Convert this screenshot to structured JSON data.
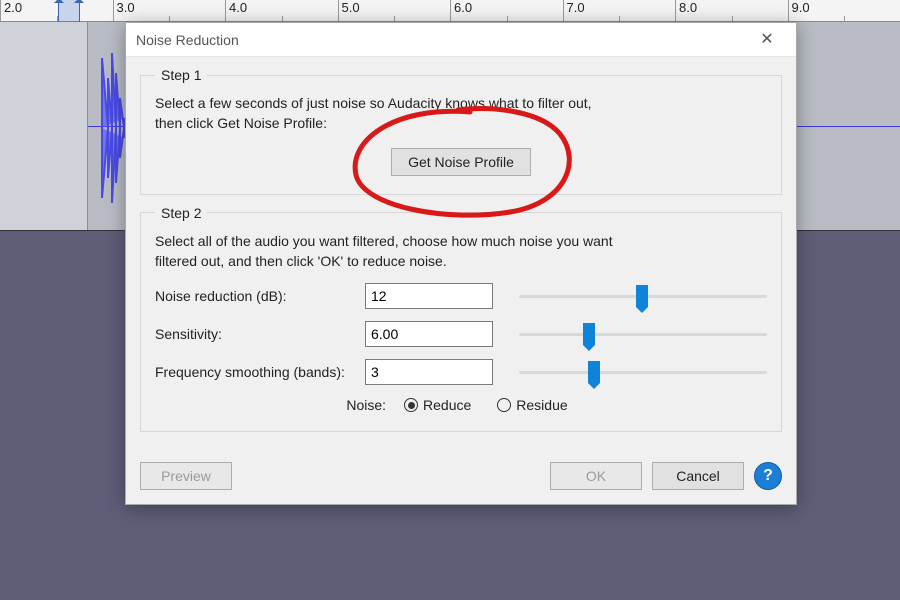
{
  "ruler": {
    "ticks": [
      "2.0",
      "3.0",
      "4.0",
      "5.0",
      "6.0",
      "7.0",
      "8.0",
      "9.0"
    ]
  },
  "dialog": {
    "title": "Noise Reduction",
    "step1": {
      "legend": "Step 1",
      "text_line1": "Select a few seconds of just noise so Audacity knows what to filter out,",
      "text_line2": "then click Get Noise Profile:",
      "button": "Get Noise Profile"
    },
    "step2": {
      "legend": "Step 2",
      "text_line1": "Select all of the audio you want filtered, choose how much noise you want",
      "text_line2": "filtered out, and then click 'OK' to reduce noise.",
      "params": {
        "noise_reduction": {
          "label": "Noise reduction (dB):",
          "value": "12",
          "slider_pct": 47
        },
        "sensitivity": {
          "label": "Sensitivity:",
          "value": "6.00",
          "slider_pct": 26
        },
        "freq_smoothing": {
          "label": "Frequency smoothing (bands):",
          "value": "3",
          "slider_pct": 28
        }
      },
      "noise_label": "Noise:",
      "noise_options": {
        "reduce": "Reduce",
        "residue": "Residue"
      },
      "noise_selected": "reduce"
    },
    "footer": {
      "preview": "Preview",
      "ok": "OK",
      "cancel": "Cancel",
      "help": "?"
    }
  }
}
